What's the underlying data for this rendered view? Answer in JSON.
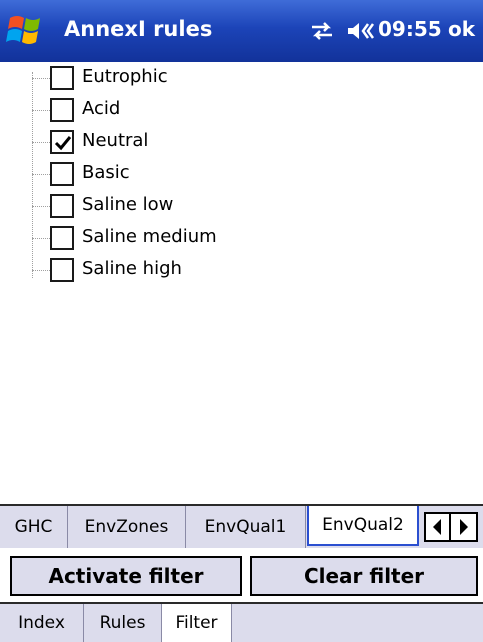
{
  "titlebar": {
    "title": "AnnexI rules",
    "time": "09:55",
    "ok_label": "ok",
    "icons": [
      "windows-start-icon",
      "connectivity-icon",
      "volume-icon"
    ]
  },
  "tree": {
    "items": [
      {
        "label": "Eutrophic",
        "checked": false
      },
      {
        "label": "Acid",
        "checked": false
      },
      {
        "label": "Neutral",
        "checked": true
      },
      {
        "label": "Basic",
        "checked": false
      },
      {
        "label": "Saline low",
        "checked": false
      },
      {
        "label": "Saline medium",
        "checked": false
      },
      {
        "label": "Saline high",
        "checked": false
      }
    ]
  },
  "upper_tabs": {
    "tabs": [
      "GHC",
      "EnvZones",
      "EnvQual1",
      "EnvQual2"
    ],
    "active": "EnvQual2"
  },
  "actions": {
    "activate_label": "Activate filter",
    "clear_label": "Clear filter"
  },
  "lower_tabs": {
    "tabs": [
      "Index",
      "Rules",
      "Filter"
    ],
    "active": "Filter"
  },
  "colors": {
    "titlebar": "#1c44b8",
    "tab_background": "#dcdcec",
    "active_tab_border": "#2b4fd0"
  }
}
